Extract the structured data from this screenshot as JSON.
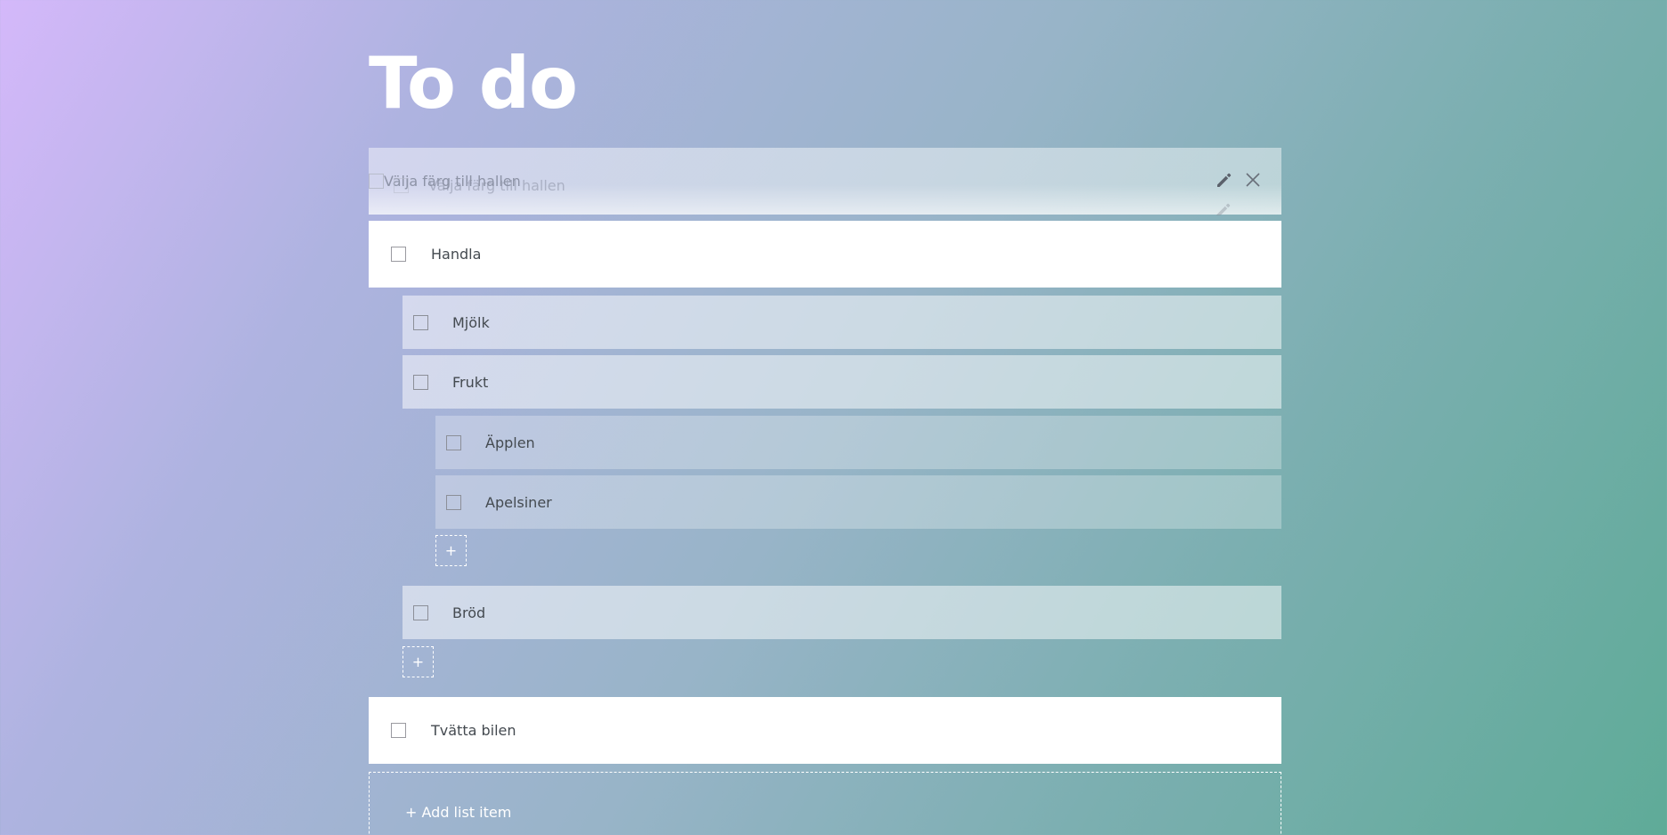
{
  "page": {
    "title": "To do"
  },
  "dragging_item": {
    "label": "Välja färg till hallen",
    "icons": [
      "pencil-icon",
      "close-icon"
    ]
  },
  "items": [
    {
      "label": "Handla",
      "children": [
        {
          "label": "Mjölk"
        },
        {
          "label": "Frukt",
          "children": [
            {
              "label": "Äpplen"
            },
            {
              "label": "Apelsiner"
            }
          ],
          "add_label": "+"
        },
        {
          "label": "Bröd"
        }
      ],
      "add_label": "+"
    },
    {
      "label": "Tvätta bilen"
    }
  ],
  "add_list_item_label": "+ Add list item",
  "colors": {
    "gradient_start": "#d4b8fa",
    "gradient_end": "#5fab98",
    "main_row": "#ffffff",
    "text": "#444a50"
  }
}
